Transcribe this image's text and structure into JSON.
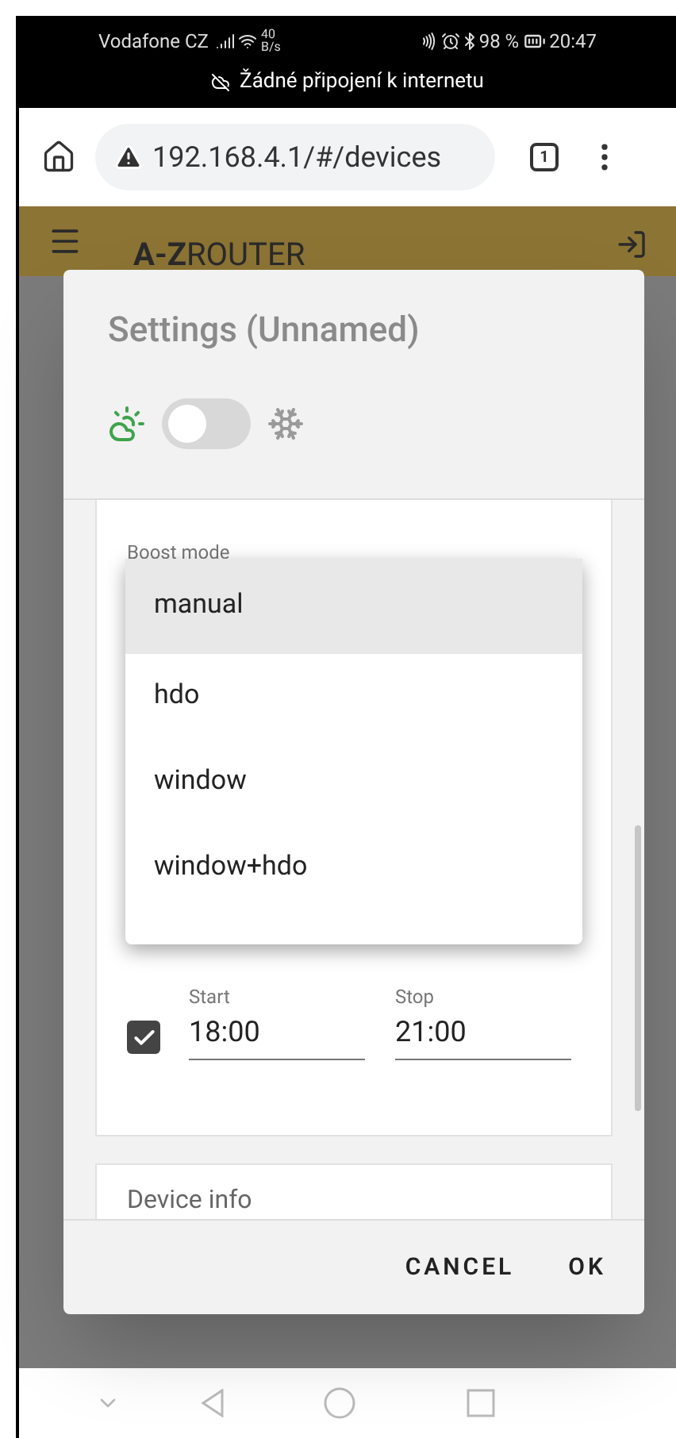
{
  "status_bar": {
    "carrier": "Vodafone CZ",
    "net_speed_value": "40",
    "net_speed_unit": "B/s",
    "battery": "98 %",
    "time": "20:47"
  },
  "offline_banner": {
    "text": "Žádné připojení k internetu"
  },
  "browser": {
    "url": "192.168.4.1/#/devices",
    "tab_count": "1"
  },
  "app_bar": {
    "title": "**A-Z**ROUTER"
  },
  "dialog": {
    "title": "Settings (Unnamed)",
    "mode_switch": {
      "on": false
    },
    "boost_mode": {
      "label": "Boost mode",
      "expanded": true,
      "options": [
        {
          "label": "manual",
          "selected": true
        },
        {
          "label": "hdo",
          "selected": false
        },
        {
          "label": "window",
          "selected": false
        },
        {
          "label": "window+hdo",
          "selected": false
        }
      ]
    },
    "schedule": {
      "enabled": true,
      "start": {
        "label": "Start",
        "value": "18:00"
      },
      "stop": {
        "label": "Stop",
        "value": "21:00"
      }
    },
    "device_info": {
      "title": "Device info"
    },
    "buttons": [
      {
        "label": "CANCEL"
      },
      {
        "label": "OK"
      }
    ]
  }
}
